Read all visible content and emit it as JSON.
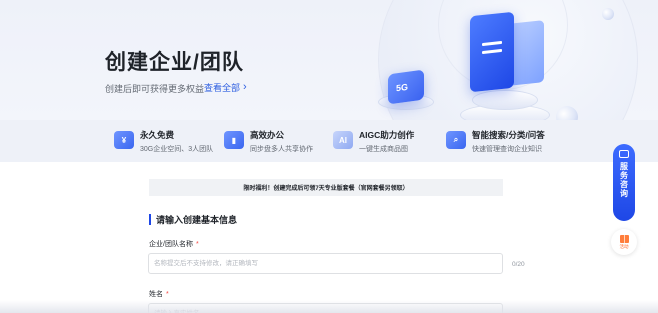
{
  "hero": {
    "title": "创建企业/团队",
    "subtitle": "创建后即可获得更多权益",
    "link": "查看全部",
    "badge_text": "5G"
  },
  "features": [
    {
      "title": "永久免费",
      "desc": "30G企业空间、3人团队",
      "icon": "coin-icon"
    },
    {
      "title": "高效办公",
      "desc": "同步盘多人共享协作",
      "icon": "chart-icon"
    },
    {
      "title": "AIGC助力创作",
      "desc": "一键生成商品图",
      "icon": "ai-icon"
    },
    {
      "title": "智能搜索/分类/问答",
      "desc": "快速管理查询企业知识",
      "icon": "search-icon"
    }
  ],
  "notice": "限时福利！创建完成后可领7天专业版套餐（官网套餐另领取）",
  "form": {
    "section_title": "请输入创建基本信息",
    "name_label": "企业/团队名称",
    "name_placeholder": "名称提交后不支持修改，请正确填写",
    "name_counter": "0/20",
    "person_label": "姓名",
    "person_placeholder": "请输入真实姓名"
  },
  "float": {
    "consult_label": "服务咨询",
    "activity_label": "活动"
  },
  "colors": {
    "accent": "#1e47e6",
    "required": "#f54a45"
  }
}
